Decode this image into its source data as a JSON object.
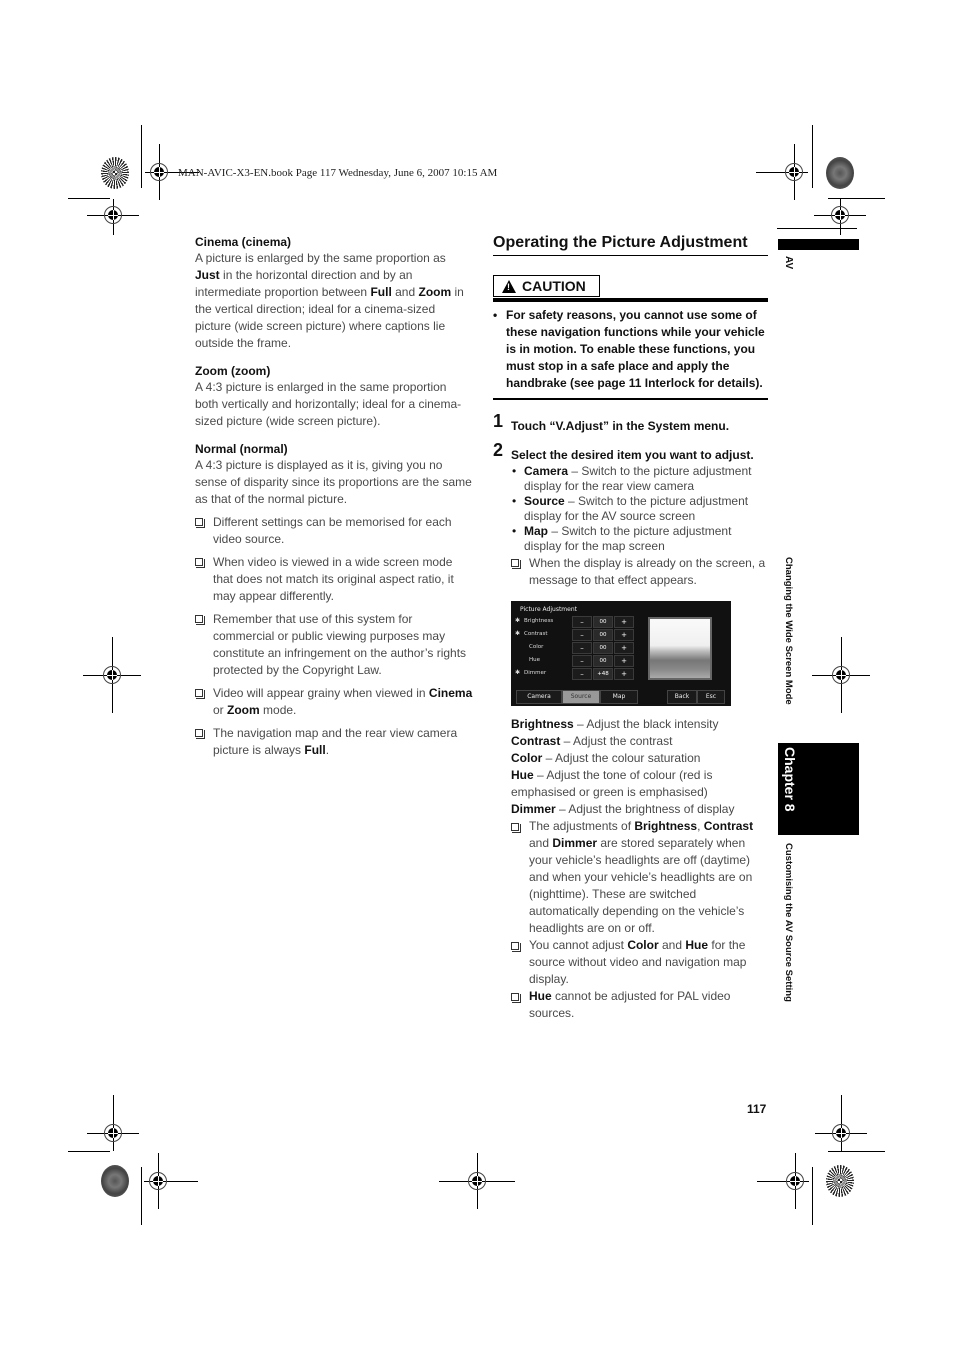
{
  "book_header": "MAN-AVIC-X3-EN.book  Page 117  Wednesday, June 6, 2007  10:15 AM",
  "left_column": {
    "cinema": {
      "heading": "Cinema (cinema)",
      "body_parts": [
        "A picture is enlarged by the same proportion as ",
        "Just",
        " in the horizontal direction and by an intermediate proportion between ",
        "Full",
        " and ",
        "Zoom",
        " in the vertical direction; ideal for a cinema-sized picture (wide screen picture) where captions lie outside the frame."
      ]
    },
    "zoom": {
      "heading": "Zoom (zoom)",
      "body": "A 4:3 picture is enlarged in the same proportion both vertically and horizontally; ideal for a cinema-sized picture (wide screen picture)."
    },
    "normal": {
      "heading": "Normal (normal)",
      "body": "A 4:3 picture is displayed as it is, giving you no sense of disparity since its proportions are the same as that of the normal picture."
    },
    "notes": {
      "n1": "Different settings can be memorised for each video source.",
      "n2": "When video is viewed in a wide screen mode that does not match its original aspect ratio, it may appear differently.",
      "n3": "Remember that use of this system for commercial or public viewing purposes may constitute an infringement on the author’s rights protected by the Copyright Law.",
      "n4_pre": "Video will appear grainy when viewed in ",
      "n4_b1": "Cinema",
      "n4_mid": " or ",
      "n4_b2": "Zoom",
      "n4_post": " mode.",
      "n5_pre": "The navigation map and the rear view camera picture is always ",
      "n5_b": "Full",
      "n5_post": "."
    }
  },
  "right_column": {
    "section_title": "Operating the Picture Adjustment",
    "caution_label": "CAUTION",
    "caution_bullet": "•",
    "caution_text": "For safety reasons, you cannot use some of these navigation functions while your vehicle is in motion. To enable these functions, you must stop in a safe place and apply the handbrake (see page 11 Interlock for details).",
    "step1_num": "1",
    "step1_text": "Touch “V.Adjust” in the System menu.",
    "step2_num": "2",
    "step2_text": "Select the desired item you want to adjust.",
    "options": [
      {
        "name": "Camera",
        "desc": " – Switch to the picture adjustment display for the rear view camera"
      },
      {
        "name": "Source",
        "desc": " – Switch to the picture adjustment display for the AV source screen"
      },
      {
        "name": "Map",
        "desc": " – Switch to the picture adjustment display for the map screen"
      }
    ],
    "bullet": "•",
    "display_note": "When the display is already on the screen, a message to that effect appears.",
    "screen": {
      "title": "Picture Adjustment",
      "rows": [
        {
          "marker": "✱",
          "label": "Brightness",
          "minus": "–",
          "value": "00",
          "plus": "+"
        },
        {
          "marker": "✱",
          "label": "Contrast",
          "minus": "–",
          "value": "00",
          "plus": "+"
        },
        {
          "marker": "",
          "label": "Color",
          "minus": "–",
          "value": "00",
          "plus": "+"
        },
        {
          "marker": "",
          "label": "Hue",
          "minus": "–",
          "value": "00",
          "plus": "+"
        },
        {
          "marker": "✱",
          "label": "Dimmer",
          "minus": "–",
          "value": "+48",
          "plus": "+"
        }
      ],
      "tabs": [
        "Camera",
        "Source",
        "Map"
      ],
      "active_tab": "Source",
      "back": "Back",
      "esc": "Esc"
    },
    "definitions": [
      {
        "term": "Brightness",
        "desc": " – Adjust the black intensity"
      },
      {
        "term": "Contrast",
        "desc": " – Adjust the contrast"
      },
      {
        "term": "Color",
        "desc": " – Adjust the colour saturation"
      },
      {
        "term": "Hue",
        "desc": " – Adjust the tone of colour (red is emphasised or green is emphasised)"
      },
      {
        "term": "Dimmer",
        "desc": " – Adjust the brightness of display"
      }
    ],
    "notes": {
      "a_pre": "The adjustments of ",
      "a_b1": "Brightness",
      "a_sep": ", ",
      "a_b2": "Contrast",
      "a_and": " and ",
      "a_b3": "Dimmer",
      "a_post": " are stored separately when your vehicle’s headlights are off (daytime) and when your vehicle’s headlights are on (nighttime). These are switched automatically depending on the vehicle’s headlights are on or off.",
      "b_pre": "You cannot adjust ",
      "b_b1": "Color",
      "b_and": " and ",
      "b_b2": "Hue",
      "b_post": " for the source without video and navigation map display.",
      "c_b": "Hue",
      "c_post": " cannot be adjusted for PAL video sources."
    }
  },
  "side_tab": {
    "section": "AV",
    "chapter_title": "Changing the Wide Screen Mode",
    "chapter_label": "Chapter 8",
    "subtitle": "Customising the AV Source Setting"
  },
  "page_number": "117"
}
